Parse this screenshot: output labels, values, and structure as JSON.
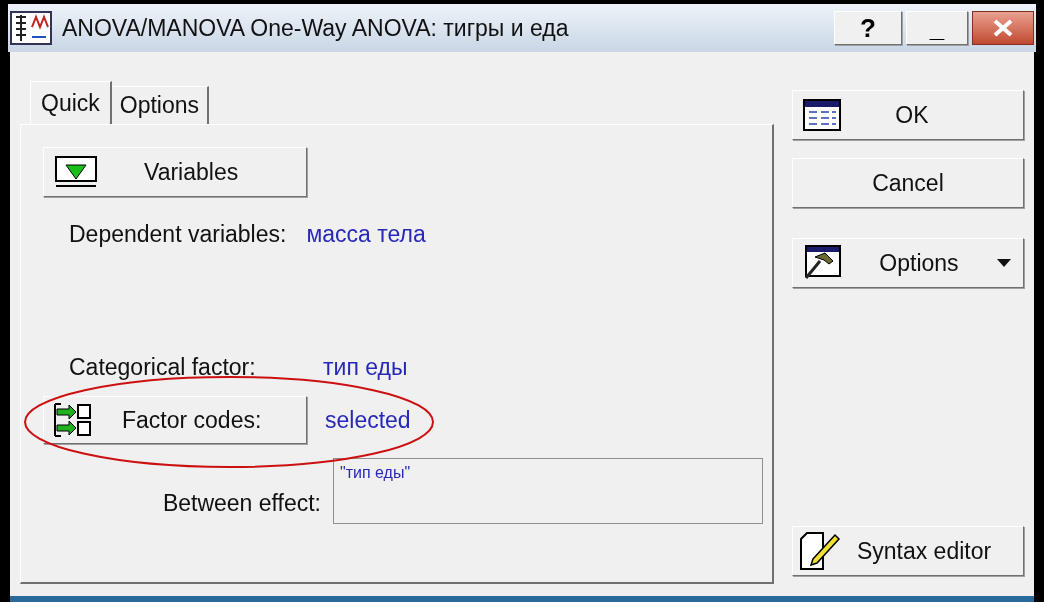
{
  "window": {
    "title": "ANOVA/MANOVA One-Way ANOVA: тигры и еда",
    "controls": [
      {
        "kind": "help",
        "label": "?"
      },
      {
        "kind": "minimize",
        "label": "_"
      },
      {
        "kind": "close"
      }
    ]
  },
  "tabs": [
    {
      "label": "Quick",
      "selected": true
    },
    {
      "label": "Options",
      "selected": false
    }
  ],
  "variables_button": {
    "label": "Variables"
  },
  "dependent": {
    "label": "Dependent variables:",
    "value": "масса тела"
  },
  "categorical": {
    "label": "Categorical factor:",
    "value": "тип еды"
  },
  "factor_codes": {
    "label": "Factor codes:",
    "value": "selected",
    "highlighted": true
  },
  "between_effect": {
    "label": "Between effect:",
    "value": "\"тип еды\""
  },
  "side_buttons": [
    {
      "kind": "ok",
      "label": "OK"
    },
    {
      "kind": "plain",
      "label": "Cancel"
    },
    {
      "kind": "menu",
      "label": "Options"
    },
    {
      "kind": "syntax",
      "label": "Syntax editor"
    }
  ]
}
